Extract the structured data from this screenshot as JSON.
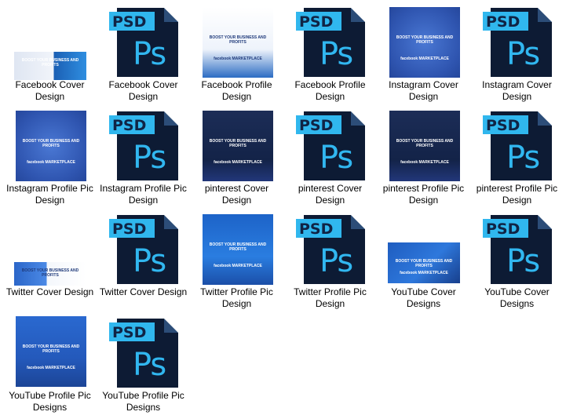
{
  "files": [
    {
      "label": "Facebook Cover Design",
      "type": "image",
      "thumb": "fb-cover",
      "thumb_text": "BOOST YOUR BUSINESS AND PROFITS"
    },
    {
      "label": "Facebook Cover Design",
      "type": "psd"
    },
    {
      "label": "Facebook Profile Design",
      "type": "image",
      "thumb": "fb-profile",
      "thumb_text": "BOOST YOUR BUSINESS AND PROFITS",
      "thumb_sub": "facebook MARKETPLACE"
    },
    {
      "label": "Facebook Profile Design",
      "type": "psd"
    },
    {
      "label": "Instagram Cover Design",
      "type": "image",
      "thumb": "ig",
      "thumb_text": "BOOST YOUR BUSINESS AND PROFITS",
      "thumb_sub": "facebook MARKETPLACE"
    },
    {
      "label": "Instagram Cover Design",
      "type": "psd"
    },
    {
      "label": "Instagram Profile Pic Design",
      "type": "image",
      "thumb": "ig",
      "thumb_text": "BOOST YOUR BUSINESS AND PROFITS",
      "thumb_sub": "facebook MARKETPLACE"
    },
    {
      "label": "Instagram Profile Pic Design",
      "type": "psd"
    },
    {
      "label": "pinterest Cover Design",
      "type": "image",
      "thumb": "pin",
      "thumb_text": "BOOST YOUR BUSINESS AND PROFITS",
      "thumb_sub": "facebook MARKETPLACE"
    },
    {
      "label": "pinterest Cover Design",
      "type": "psd"
    },
    {
      "label": "pinterest Profile Pic Design",
      "type": "image",
      "thumb": "pin",
      "thumb_text": "BOOST YOUR BUSINESS AND PROFITS",
      "thumb_sub": "facebook MARKETPLACE"
    },
    {
      "label": "pinterest Profile Pic Design",
      "type": "psd"
    },
    {
      "label": "Twitter Cover Design",
      "type": "image",
      "thumb": "tw-cover",
      "thumb_text": "BOOST YOUR BUSINESS AND PROFITS"
    },
    {
      "label": "Twitter Cover Design",
      "type": "psd"
    },
    {
      "label": "Twitter Profile Pic Design",
      "type": "image",
      "thumb": "tw-profile",
      "thumb_text": "BOOST YOUR BUSINESS AND PROFITS",
      "thumb_sub": "facebook MARKETPLACE"
    },
    {
      "label": "Twitter Profile Pic Design",
      "type": "psd"
    },
    {
      "label": "YouTube Cover Designs",
      "type": "image",
      "thumb": "yt-cover",
      "thumb_text": "BOOST YOUR BUSINESS AND PROFITS",
      "thumb_sub": "facebook MARKETPLACE"
    },
    {
      "label": "YouTube Cover Designs",
      "type": "psd"
    },
    {
      "label": "YouTube Profile Pic Designs",
      "type": "image",
      "thumb": "yt-profile",
      "thumb_text": "BOOST YOUR BUSINESS AND PROFITS",
      "thumb_sub": "facebook MARKETPLACE"
    },
    {
      "label": "YouTube Profile Pic Designs",
      "type": "psd"
    }
  ],
  "psd_icon": {
    "tab_text": "PSD",
    "glyph_text": "Ps"
  }
}
